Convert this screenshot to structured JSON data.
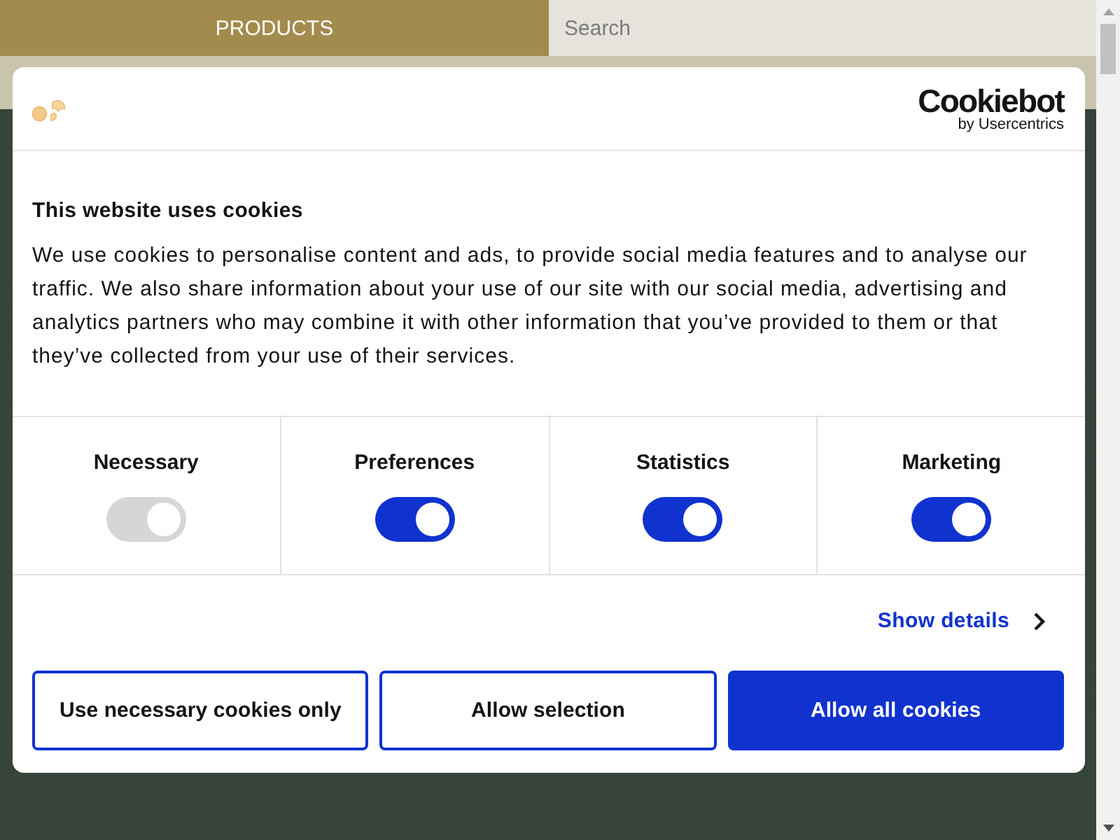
{
  "header": {
    "nav_label": "PRODUCTS",
    "search": {
      "placeholder": "Search"
    }
  },
  "dialog": {
    "logo": {
      "name": "Cookiebot",
      "tagline": "by Usercentrics"
    },
    "title": "This website uses cookies",
    "body": "We use cookies to personalise content and ads, to provide social media features and to analyse our traffic. We also share information about your use of our site with our social media, advertising and analytics partners who may combine it with other information that you’ve provided to them or that they’ve collected from your use of their services.",
    "categories": [
      {
        "label": "Necessary",
        "on": true,
        "disabled": true
      },
      {
        "label": "Preferences",
        "on": true,
        "disabled": false
      },
      {
        "label": "Statistics",
        "on": true,
        "disabled": false
      },
      {
        "label": "Marketing",
        "on": true,
        "disabled": false
      }
    ],
    "details_link": "Show details",
    "buttons": [
      {
        "label": "Use necessary cookies only",
        "kind": "outline"
      },
      {
        "label": "Allow selection",
        "kind": "outline"
      },
      {
        "label": "Allow all cookies",
        "kind": "filled"
      }
    ]
  }
}
